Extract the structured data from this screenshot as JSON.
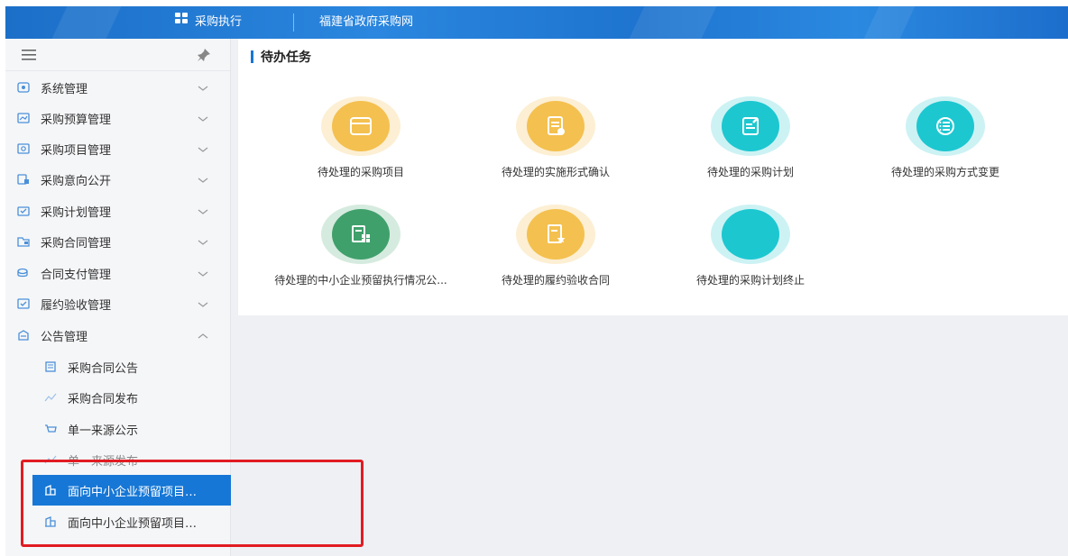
{
  "topbar": {
    "module_label": "采购执行",
    "site_label": "福建省政府采购网"
  },
  "sidebar": {
    "menu_icon": "hamburger-menu-icon",
    "pin_icon": "pin-icon",
    "items": [
      {
        "label": "系统管理",
        "icon": "system-settings-icon"
      },
      {
        "label": "采购预算管理",
        "icon": "budget-icon"
      },
      {
        "label": "采购项目管理",
        "icon": "project-icon"
      },
      {
        "label": "采购意向公开",
        "icon": "intent-icon"
      },
      {
        "label": "采购计划管理",
        "icon": "plan-icon"
      },
      {
        "label": "采购合同管理",
        "icon": "contract-icon"
      },
      {
        "label": "合同支付管理",
        "icon": "payment-icon"
      },
      {
        "label": "履约验收管理",
        "icon": "acceptance-icon"
      },
      {
        "label": "公告管理",
        "icon": "announcement-icon",
        "expanded": true
      }
    ],
    "sub_items": [
      {
        "label": "采购合同公告",
        "icon": "doc-icon"
      },
      {
        "label": "采购合同发布",
        "icon": "chart-icon"
      },
      {
        "label": "单一来源公示",
        "icon": "cart-icon"
      },
      {
        "label": "单一来源发布",
        "icon": "chart-icon"
      },
      {
        "label": "面向中小企业预留项目…",
        "icon": "building-icon",
        "active": true
      },
      {
        "label": "面向中小企业预留项目…",
        "icon": "building-icon"
      }
    ]
  },
  "main": {
    "section_title": "待办任务",
    "tasks": [
      {
        "label": "待处理的采购项目",
        "icon": "folder-icon",
        "color": "#f4c04f",
        "ring": "#fcefd3"
      },
      {
        "label": "待处理的实施形式确认",
        "icon": "doc-check-icon",
        "color": "#f4c04f",
        "ring": "#fcefd3"
      },
      {
        "label": "待处理的采购计划",
        "icon": "edit-doc-icon",
        "color": "#1cc7d0",
        "ring": "#cdf2f4"
      },
      {
        "label": "待处理的采购方式变更",
        "icon": "list-refresh-icon",
        "color": "#1cc7d0",
        "ring": "#cdf2f4"
      },
      {
        "label": "待处理的中小企业预留执行情况公...",
        "icon": "grid-doc-icon",
        "color": "#3fa06b",
        "ring": "#d6ebdf"
      },
      {
        "label": "待处理的履约验收合同",
        "icon": "star-doc-icon",
        "color": "#f4c04f",
        "ring": "#fcefd3"
      },
      {
        "label": "待处理的采购计划终止",
        "icon": "blank-circle-icon",
        "color": "#1cc7d0",
        "ring": "#cdf2f4"
      }
    ]
  },
  "colors": {
    "topbar": "#1e74cf",
    "active_item": "#1677d6",
    "highlight": "#e11b22"
  }
}
